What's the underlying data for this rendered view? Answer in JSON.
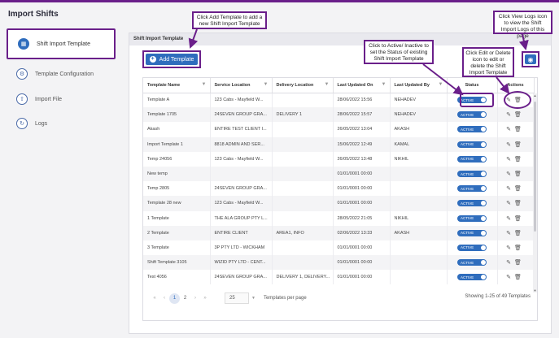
{
  "page": {
    "title": "Import Shifts"
  },
  "sidebar": {
    "items": [
      {
        "label": "Shift Import Template",
        "icon": "document-icon",
        "active": true
      },
      {
        "label": "Template Configuration",
        "icon": "gears-icon"
      },
      {
        "label": "Import File",
        "icon": "upload-icon"
      },
      {
        "label": "Logs",
        "icon": "history-icon"
      }
    ]
  },
  "panel": {
    "title": "Shift Import Template",
    "add_button": "Add Template"
  },
  "table": {
    "headers": [
      "Template Name",
      "Service Location",
      "Delivery Location",
      "Last Updated On",
      "Last Updated By",
      "Status",
      "Actions"
    ],
    "status_label": "ACTIVE",
    "rows": [
      [
        "Template A",
        "123 Cabs - Mayfield W...",
        "",
        "28/06/2022 15:56",
        "NEHADEV"
      ],
      [
        "Template 1705",
        "24SEVEN GROUP GRA...",
        "DELIVERY 1",
        "28/06/2022 15:57",
        "NEHADEV"
      ],
      [
        "Akash",
        "ENTIRE TEST CLIENT I...",
        "",
        "26/05/2022 13:04",
        "AKASH"
      ],
      [
        "Import Template 1",
        "8818 ADMIN AND SER...",
        "",
        "15/06/2022 12:49",
        "KAMAL"
      ],
      [
        "Temp 24056",
        "123 Cabs - Mayfield W...",
        "",
        "26/05/2022 13:48",
        "NIKHIL"
      ],
      [
        "New temp",
        "",
        "",
        "01/01/0001 00:00",
        ""
      ],
      [
        "Temp 2805",
        "24SEVEN GROUP GRA...",
        "",
        "01/01/0001 00:00",
        ""
      ],
      [
        "Template 28 new",
        "123 Cabs - Mayfield W...",
        "",
        "01/01/0001 00:00",
        ""
      ],
      [
        "1 Template",
        "THE ALA GROUP PTY L...",
        "",
        "28/05/2022 21:05",
        "NIKHIL"
      ],
      [
        "2 Template",
        "ENTIRE CLIENT",
        "AREA1, INFO",
        "02/06/2022 13:33",
        "AKASH"
      ],
      [
        "3 Template",
        "3P PTY LTD - WICKHAM",
        "",
        "01/01/0001 00:00",
        ""
      ],
      [
        "Shift Template 3105",
        "WIZID PTY LTD - CENT...",
        "",
        "01/01/0001 00:00",
        ""
      ],
      [
        "Test 4056",
        "24SEVEN GROUP GRA...",
        "DELIVERY 1, DELIVERY...",
        "01/01/0001 00:00",
        ""
      ]
    ]
  },
  "pager": {
    "pages": [
      "1",
      "2"
    ],
    "current": "1",
    "page_size": "25",
    "page_size_label": "Templates per page",
    "summary": "Showing 1-25 of 49 Templates"
  },
  "callouts": {
    "add": "Click Add Template to add a new Shift Import Template",
    "status": "Click to Active/ Inactive to set the Status of existing Shift Import Template",
    "edit": "Click Edit or Delete icon to edit or delete the Shift Import Template",
    "logs": "Click View Logs icon to view the Shift Import Logs of this page"
  },
  "colors": {
    "accent": "#2f6dbd",
    "annotation": "#6a1f8a"
  }
}
